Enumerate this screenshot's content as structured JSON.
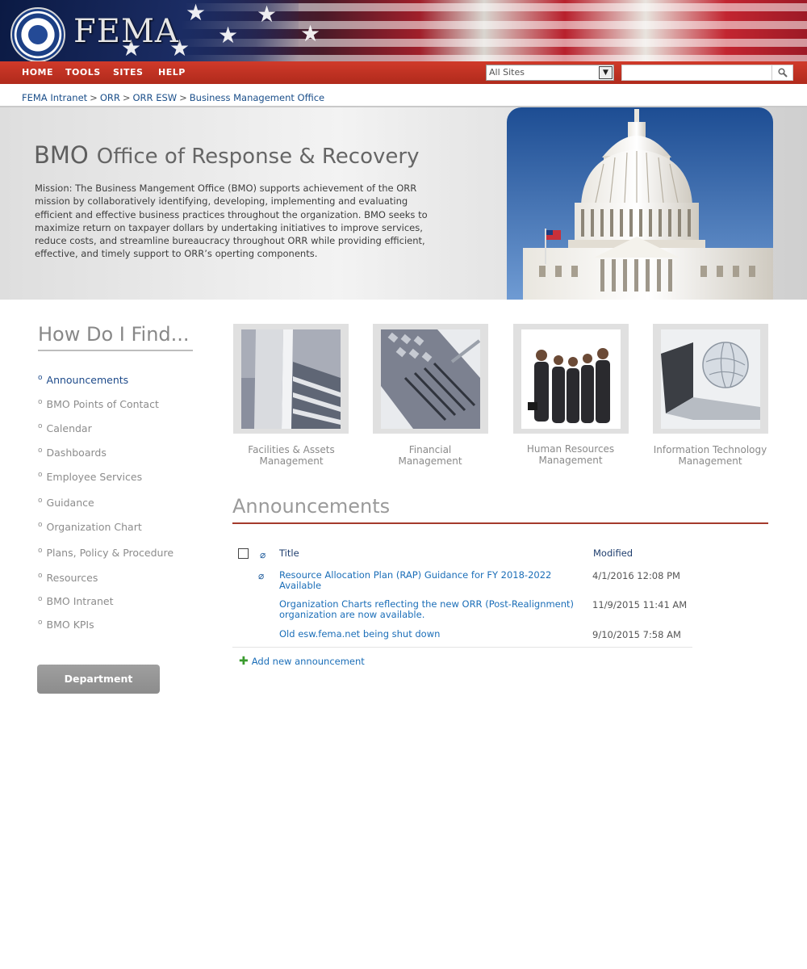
{
  "header": {
    "logo_text": "FEMA",
    "seal_text": "U.S. DEPARTMENT OF HOMELAND SECURITY"
  },
  "nav": {
    "items": [
      {
        "label": "HOME"
      },
      {
        "label": "TOOLS"
      },
      {
        "label": "SITES"
      },
      {
        "label": "HELP"
      }
    ],
    "scope_select": "All Sites",
    "search_placeholder": ""
  },
  "breadcrumb": [
    "FEMA Intranet",
    "ORR",
    "ORR ESW",
    "Business Management Office"
  ],
  "hero": {
    "abbr": "BMO",
    "title": "Office of Response & Recovery",
    "mission": "Mission: The Business Mangement Office (BMO) supports achievement of the ORR mission by collaboratively identifying, developing, implementing and evaluating efficient and effective business practices throughout the organization. BMO seeks to maximize return on taxpayer dollars by undertaking initiatives to improve services, reduce costs, and streamline bureaucracy throughout ORR while providing efficient, effective, and timely support to ORR’s operting components."
  },
  "sidebar": {
    "heading": "How Do I Find...",
    "links": [
      {
        "label": "Announcements"
      },
      {
        "label": "BMO Points of Contact"
      },
      {
        "label": "Calendar"
      },
      {
        "label": "Dashboards"
      },
      {
        "label": "Employee Services"
      },
      {
        "label": "Guidance"
      },
      {
        "label": "Organization Chart"
      },
      {
        "label": "Plans, Policy & Procedure"
      },
      {
        "label": "Resources"
      },
      {
        "label": "BMO Intranet"
      },
      {
        "label": "BMO KPIs"
      }
    ],
    "button": "Department Requests"
  },
  "tiles": [
    {
      "line1": "Facilities & Assets",
      "line2": "Management"
    },
    {
      "line1": "Financial",
      "line2": "Management"
    },
    {
      "line1": "Human Resources",
      "line2": "Management"
    },
    {
      "line1": "Information Technology",
      "line2": "Management"
    }
  ],
  "announcements": {
    "heading": "Announcements",
    "col_title": "Title",
    "col_modified": "Modified",
    "rows": [
      {
        "title": "Resource Allocation Plan (RAP) Guidance for FY 2018-2022 Available",
        "modified": "4/1/2016 12:08 PM"
      },
      {
        "title": "Organization Charts reflecting the new ORR (Post-Realignment) organization are now available.",
        "modified": "11/9/2015 11:41 AM"
      },
      {
        "title": "Old esw.fema.net being shut down",
        "modified": "9/10/2015 7:58 AM"
      }
    ],
    "add_label": "Add new announcement"
  }
}
